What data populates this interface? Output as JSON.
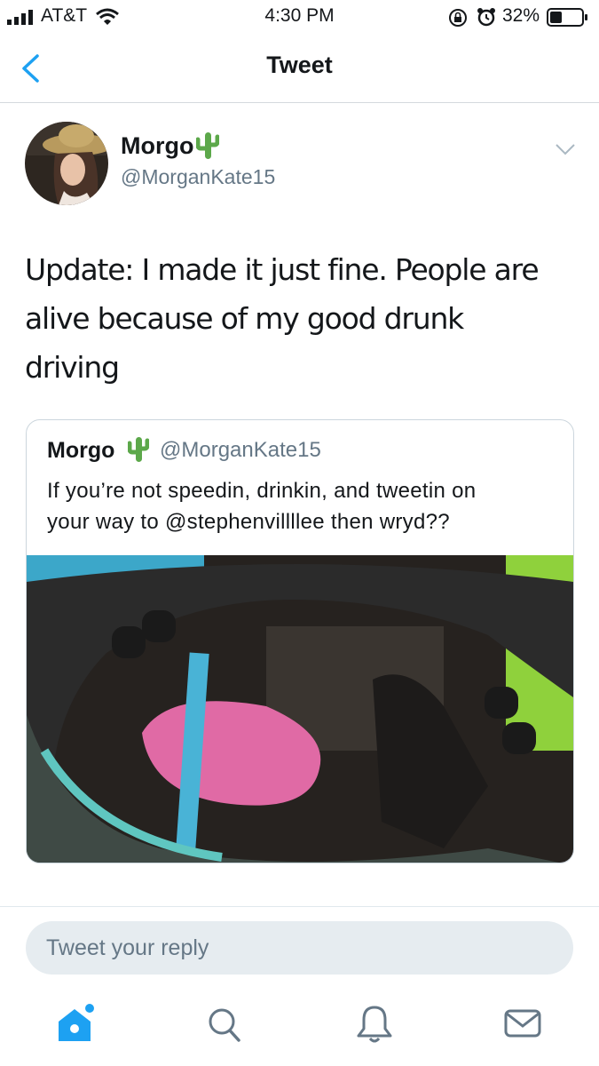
{
  "status_bar": {
    "carrier": "AT&T",
    "time": "4:30 PM",
    "battery": "32%",
    "icons": [
      "signal-icon",
      "wifi-icon",
      "lock-rotation-icon",
      "alarm-icon",
      "battery-icon"
    ]
  },
  "nav": {
    "title": "Tweet",
    "back_icon": "chevron-left-icon"
  },
  "tweet": {
    "author_name": "Morgo",
    "author_emoji": "cactus",
    "handle": "@MorganKate15",
    "line1": "Update: I made it just fine. People are",
    "line2": "alive because of my good drunk",
    "line3": "driving",
    "more_icon": "chevron-down-icon"
  },
  "quote": {
    "author_name": "Morgo",
    "handle": "@MorganKate15",
    "line1": "If you’re not speedin, drinkin, and tweetin on",
    "line2": "your way to @stephenvillllee then wryd??",
    "media": "photo-steering-wheel"
  },
  "reply": {
    "placeholder": "Tweet your reply"
  },
  "tab_bar": {
    "items": [
      "home-icon",
      "search-icon",
      "notifications-icon",
      "messages-icon"
    ],
    "active": "home-icon"
  },
  "colors": {
    "accent": "#1da1f2",
    "text": "#14171a",
    "muted": "#657786",
    "border": "#ccd6dd"
  }
}
